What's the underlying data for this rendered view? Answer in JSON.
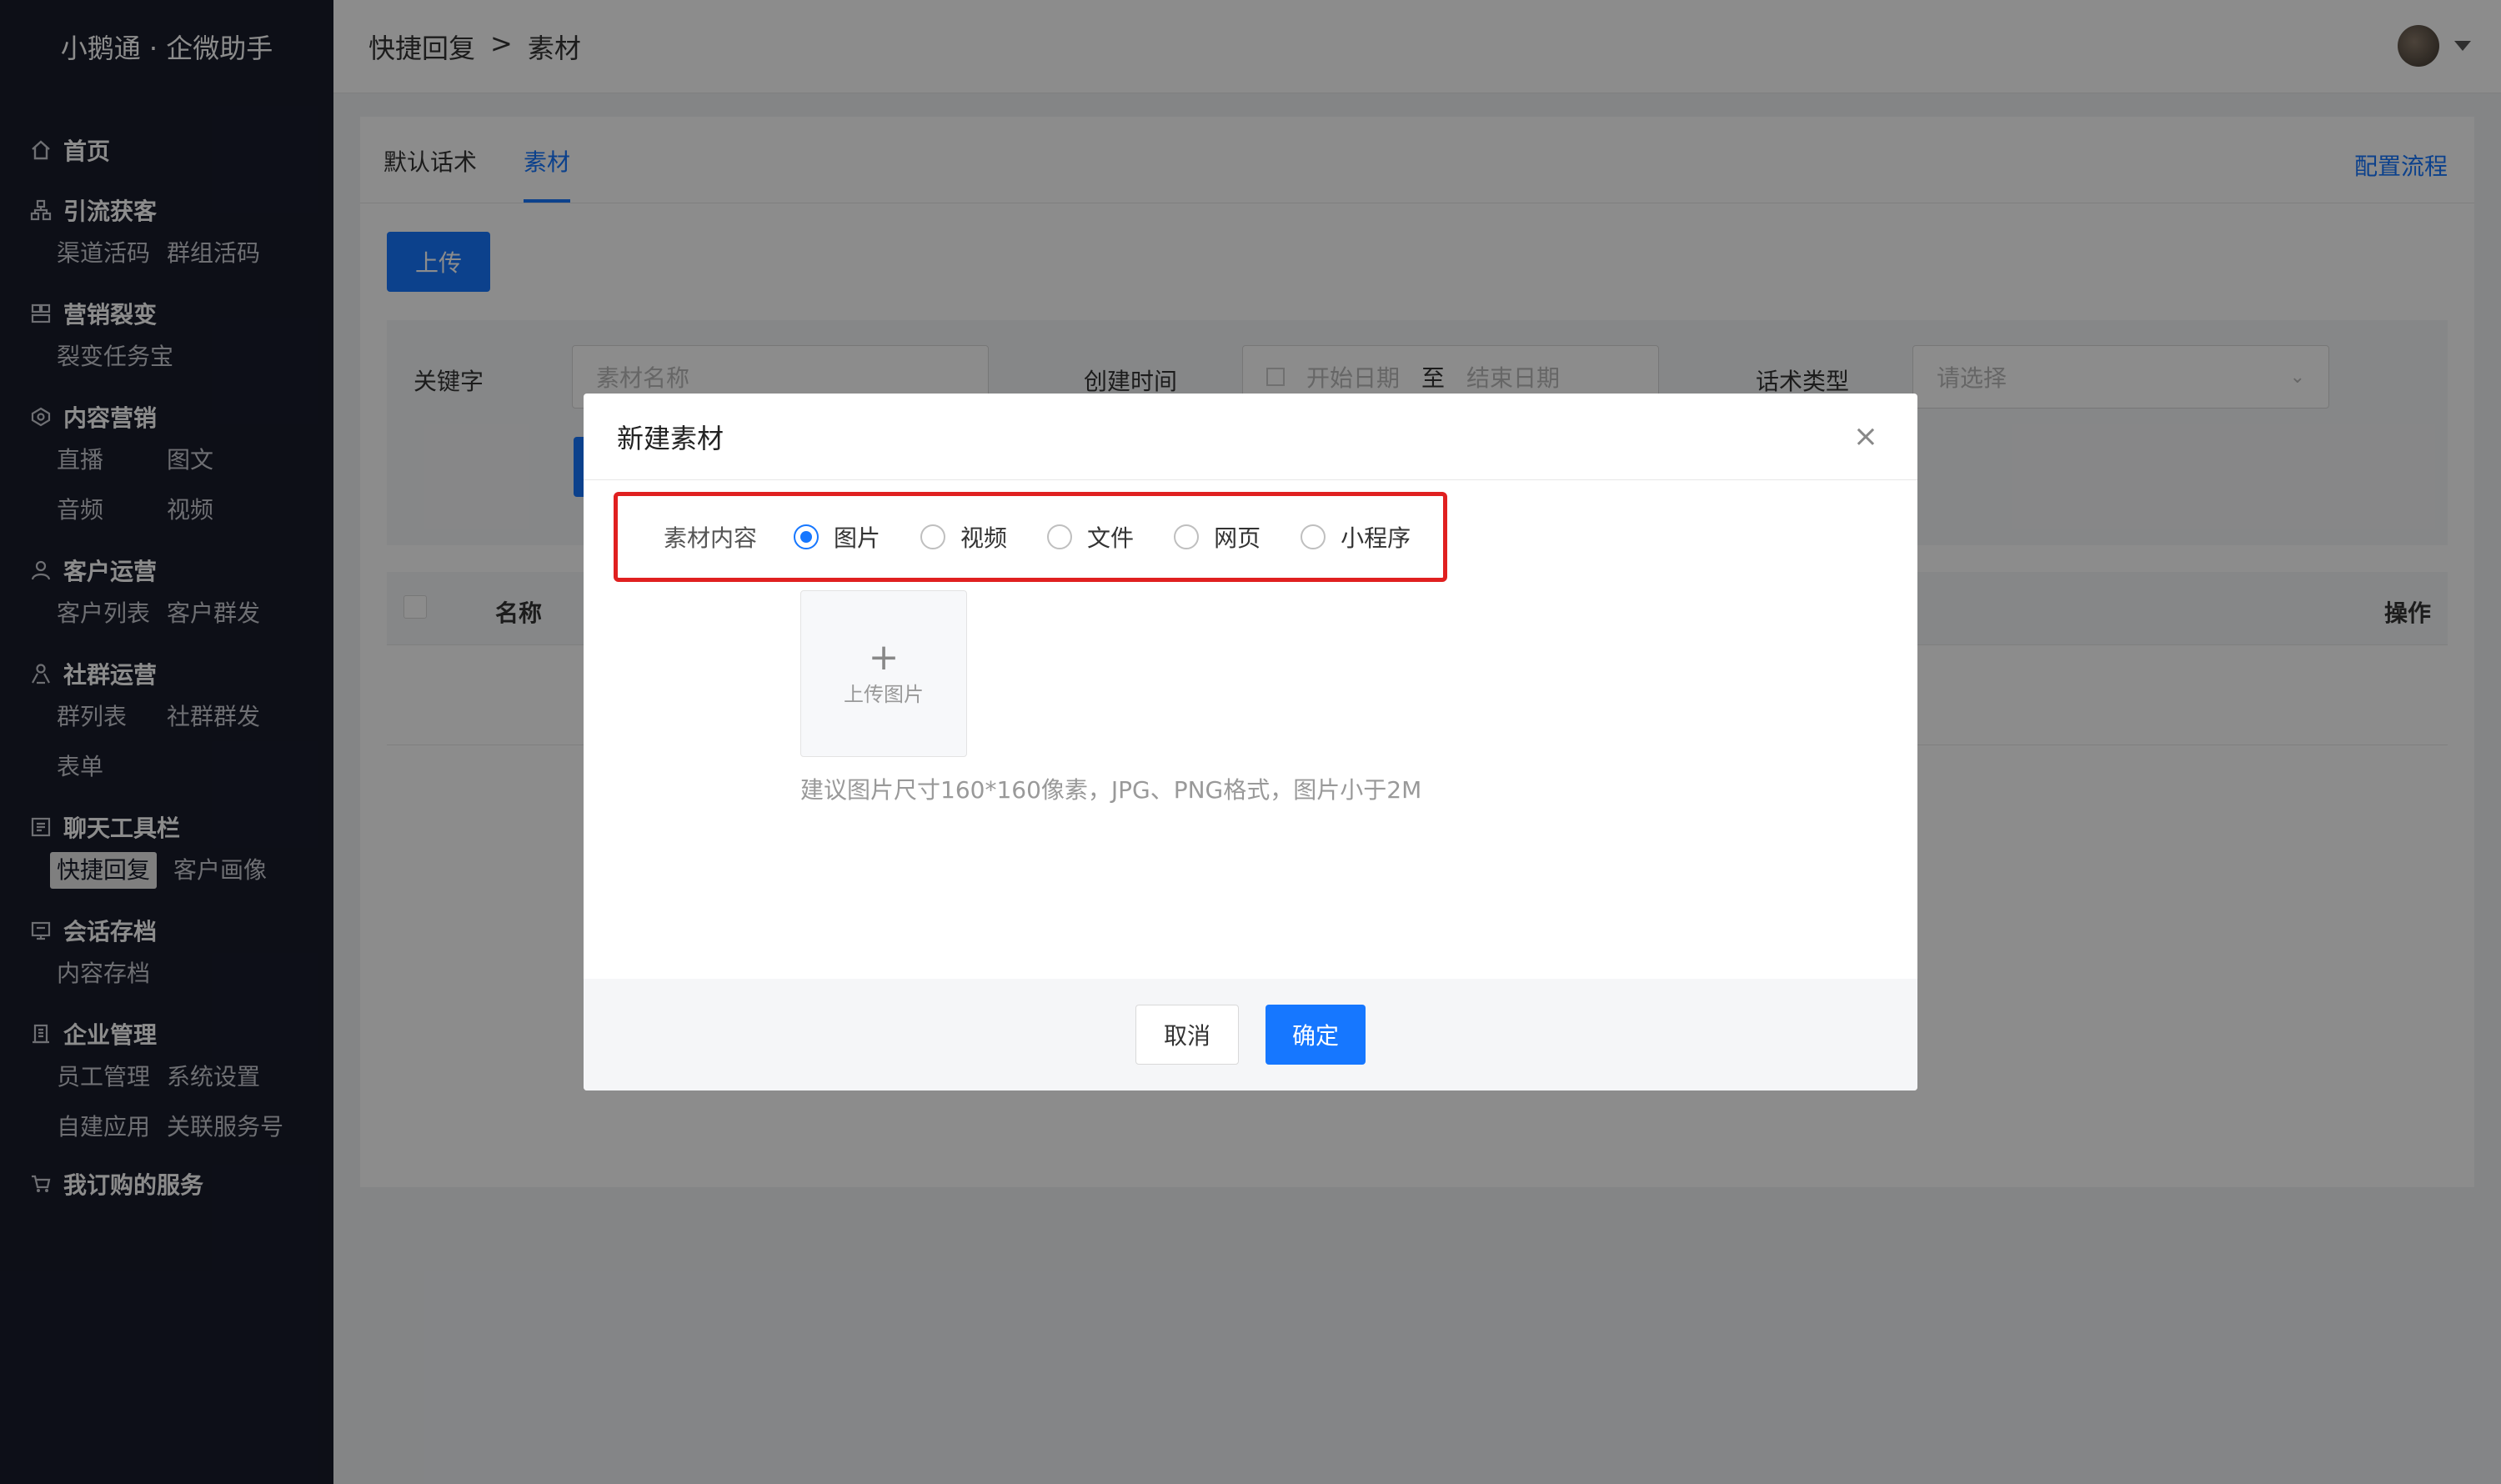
{
  "app": {
    "title": "小鹅通 · 企微助手"
  },
  "sidebar": {
    "sections": [
      {
        "title": "首页",
        "icon": "home-icon",
        "items": []
      },
      {
        "title": "引流获客",
        "icon": "org-chart-icon",
        "items": [
          "渠道活码",
          "群组活码"
        ]
      },
      {
        "title": "营销裂变",
        "icon": "network-icon",
        "items": [
          "裂变任务宝"
        ]
      },
      {
        "title": "内容营销",
        "icon": "content-icon",
        "items": [
          "直播",
          "图文",
          "音频",
          "视频"
        ]
      },
      {
        "title": "客户运营",
        "icon": "user-icon",
        "items": [
          "客户列表",
          "客户群发"
        ]
      },
      {
        "title": "社群运营",
        "icon": "group-icon",
        "items": [
          "群列表",
          "社群群发",
          "表单"
        ]
      },
      {
        "title": "聊天工具栏",
        "icon": "chat-tool-icon",
        "items": [
          "快捷回复",
          "客户画像"
        ],
        "active": "快捷回复"
      },
      {
        "title": "会话存档",
        "icon": "archive-icon",
        "items": [
          "内容存档"
        ]
      },
      {
        "title": "企业管理",
        "icon": "building-icon",
        "items": [
          "员工管理",
          "系统设置",
          "自建应用",
          "关联服务号"
        ]
      },
      {
        "title": "我订购的服务",
        "icon": "cart-icon",
        "items": []
      }
    ]
  },
  "header": {
    "breadcrumb": {
      "parent": "快捷回复",
      "separator": ">",
      "current": "素材"
    }
  },
  "main": {
    "tabs": [
      "默认话术",
      "素材"
    ],
    "active_tab": "素材",
    "config_link": "配置流程",
    "upload_button": "上传",
    "filter": {
      "keyword_label": "关键字",
      "keyword_placeholder": "素材名称",
      "time_label": "创建时间",
      "start_placeholder": "开始日期",
      "range_sep": "至",
      "end_placeholder": "结束日期",
      "type_label": "话术类型",
      "type_placeholder": "请选择"
    },
    "table": {
      "columns": [
        "名称",
        "操作"
      ]
    }
  },
  "modal": {
    "title": "新建素材",
    "content_label": "素材内容",
    "options": [
      "图片",
      "视频",
      "文件",
      "网页",
      "小程序"
    ],
    "selected": "图片",
    "uploader_text": "上传图片",
    "hint": "建议图片尺寸160*160像素，JPG、PNG格式，图片小于2M",
    "cancel": "取消",
    "confirm": "确定"
  },
  "colors": {
    "primary": "#1677ff",
    "sidebar_bg": "#181c2b",
    "highlight": "#e02020"
  }
}
